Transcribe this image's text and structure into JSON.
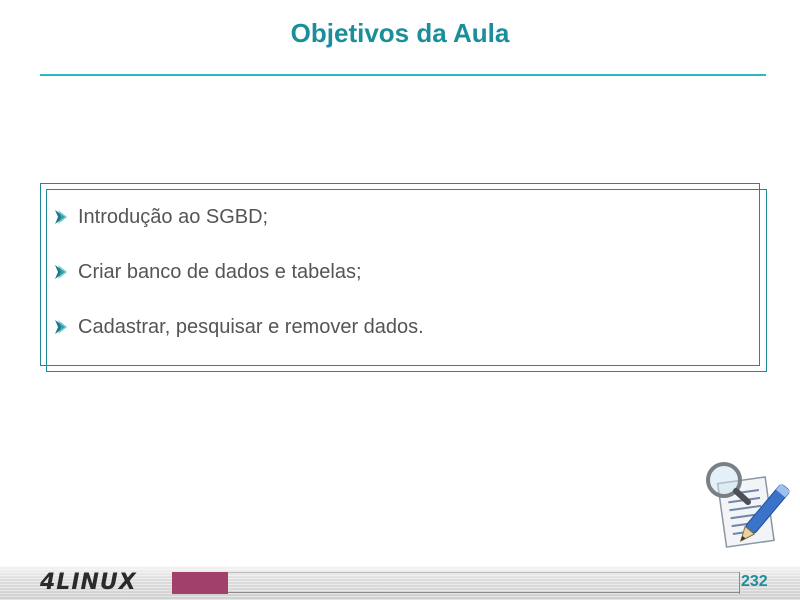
{
  "slide": {
    "title": "Objetivos da Aula",
    "bullets": [
      "Introdução ao SGBD;",
      "Criar banco de dados e tabelas;",
      "Cadastrar, pesquisar e remover dados."
    ],
    "bullet_icon": "arrow-bullet-icon",
    "clipart_icon": "magnifier-document-pen-icon"
  },
  "footer": {
    "logo": "4LINUX",
    "page_number": "232"
  },
  "colors": {
    "title": "#1a8f99",
    "rule": "#29b8c4",
    "box_border": "#1f8a96",
    "accent_bar": "#a1416a",
    "body_text": "#555555"
  }
}
